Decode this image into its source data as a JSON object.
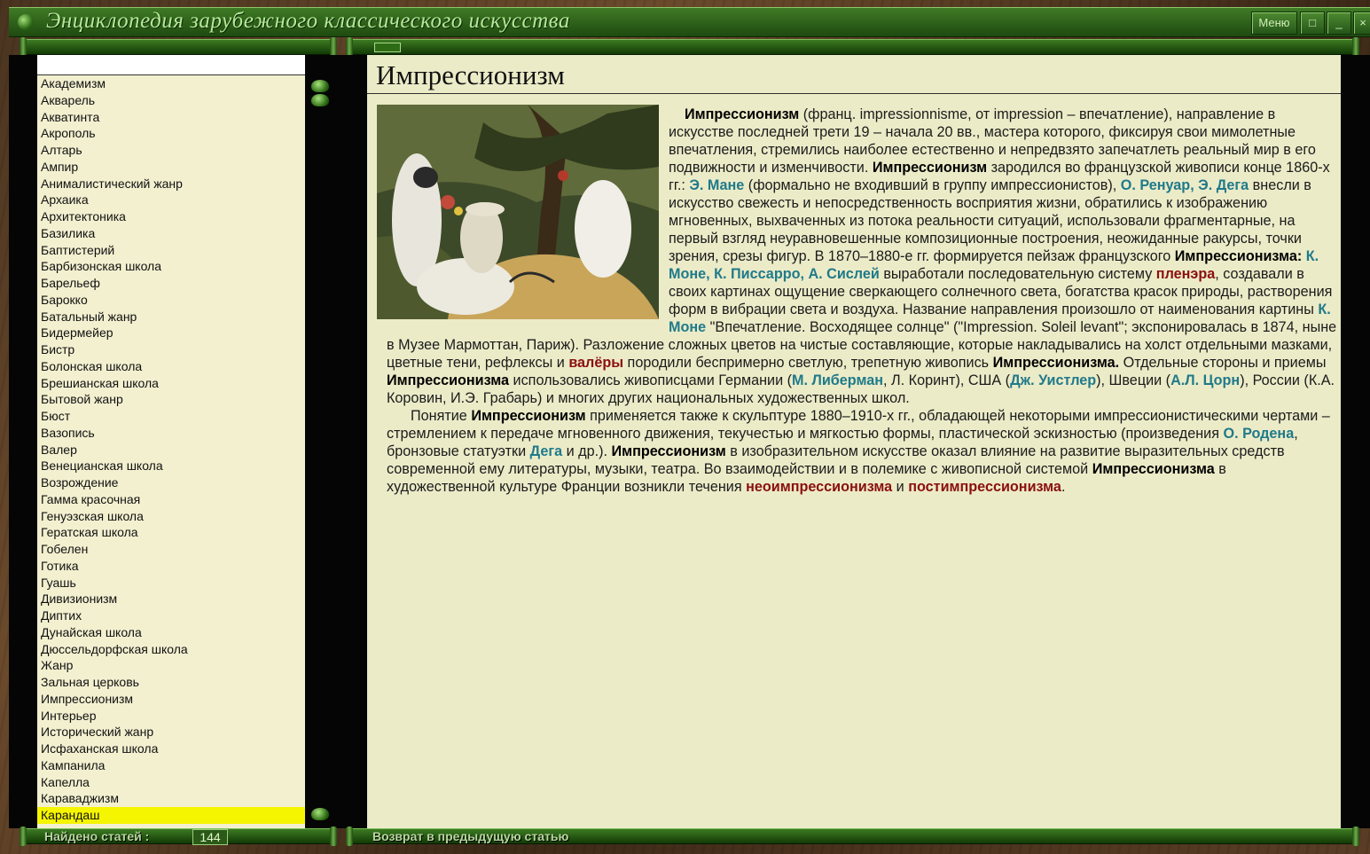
{
  "app": {
    "title": "Энциклопедия зарубежного классического искусства",
    "menu_label": "Меню"
  },
  "sidebar": {
    "search_value": "",
    "items": [
      "Академизм",
      "Акварель",
      "Акватинта",
      "Акрополь",
      "Алтарь",
      "Ампир",
      "Анималистический жанр",
      "Архаика",
      "Архитектоника",
      "Базилика",
      "Баптистерий",
      "Барбизонская школа",
      "Барельеф",
      "Барокко",
      "Батальный жанр",
      "Бидермейер",
      "Бистр",
      "Болонская школа",
      "Брешианская школа",
      "Бытовой жанр",
      "Бюст",
      "Вазопись",
      "Валер",
      "Венецианская школа",
      "Возрождение",
      "Гамма красочная",
      "Генуэзская школа",
      "Гератская школа",
      "Гобелен",
      "Готика",
      "Гуашь",
      "Дивизионизм",
      "Диптих",
      "Дунайская школа",
      "Дюссельдорфская школа",
      "Жанр",
      "Зальная церковь",
      "Импрессионизм",
      "Интерьер",
      "Исторический жанр",
      "Исфаханская школа",
      "Кампанила",
      "Капелла",
      "Караваджизм",
      "Карандаш"
    ],
    "selected_item": "Карандаш"
  },
  "article": {
    "title": "Импрессионизм",
    "image_icon": "painting-image",
    "p1_t1": "Импрессионизм",
    "p1_t2": " (франц. impressionnisme, от impression – впечатление), направление в искусстве последней трети 19 – начала 20 вв., мастера которого, фиксируя свои мимолетные впечатления, стремились наиболее естественно и непредвзято запечатлеть реальный мир в его подвижности и изменчивости. ",
    "p1_t3": "Импрессионизм",
    "p1_t4": " зародился во французской живописи конце 1860-х гг.: ",
    "p1_l1": "Э. Мане",
    "p1_t5": " (формально не входивший в группу импрессионистов), ",
    "p1_l2": "О. Ренуар, Э. Дега",
    "p1_t6": " внесли в искусство свежесть и непосредственность восприятия жизни, обратились к изображению мгновенных, выхваченных из потока реальности ситуаций, использовали фрагментарные, на первый взгляд неуравновешенные композиционные построения, неожиданные ракурсы, точки зрения, срезы фигур. В 1870–1880-е гг. формируется пейзаж французского ",
    "p1_t7": "Импрессионизма:",
    "p1_l3": "К. Моне, К. Писсарро, А. Сислей",
    "p1_t8": " выработали последовательную систему ",
    "p1_m1": "пленэра",
    "p1_t9": ", создавали в своих картинах ощущение сверкающего солнечного света, богатства красок природы, растворения форм в вибрации света и воздуха. Название направления произошло от наименования картины ",
    "p1_l4": "К. Моне",
    "p1_t10": " \"Впечатление. Восходящее солнце\" (\"Impression. Soleil levant\"; экспонировалась в 1874, ныне в Музее Мармоттан, Париж). Разложение сложных цветов на чистые составляющие, которые накладывались на холст отдельными мазками, цветные тени, рефлексы и ",
    "p1_m2": "валёры",
    "p1_t11": " породили беспримерно светлую, трепетную живопись ",
    "p1_t12": "Импрессионизма.",
    "p1_t13": " Отдельные стороны и приемы ",
    "p1_t14": "Импрессионизма",
    "p1_t15": " использовались живописцами Германии (",
    "p1_l5": "М. Либерман",
    "p1_t16": ", Л. Коринт), США (",
    "p1_l6": "Дж. Уистлер",
    "p1_t17": "), Швеции (",
    "p1_l7": "А.Л. Цорн",
    "p1_t18": "), России (К.А. Коровин, И.Э. Грабарь) и многих других национальных художественных школ.",
    "p2_t1": "Понятие ",
    "p2_t2": "Импрессионизм",
    "p2_t3": " применяется также к скульптуре 1880–1910-х гг., обладающей некоторыми импрессионистическими чертами – стремлением к передаче мгновенного движения, текучестью и мягкостью формы, пластической эскизностью (произведения ",
    "p2_l1": "О. Родена",
    "p2_t4": ", бронзовые статуэтки ",
    "p2_l2": "Дега",
    "p2_t5": " и др.). ",
    "p2_t6": "Импрессионизм",
    "p2_t7": " в изобразительном искусстве оказал влияние на развитие выразительных средств современной ему литературы, музыки, театра. Во взаимодействии и в полемике с живописной системой ",
    "p2_t8": "Импрессионизма",
    "p2_t9": " в художественной культуре Франции возникли течения ",
    "p2_m1": "неоимпрессионизма",
    "p2_t10": " и ",
    "p2_m2": "постимпрессионизма",
    "p2_t11": "."
  },
  "status": {
    "count_label": "Найдено статей :",
    "count_value": "144",
    "back_label": "Возврат в предыдущую статью"
  },
  "colors": {
    "frame_green": "#2e6b15",
    "link_teal": "#1f7a8a",
    "term_red": "#8a1010",
    "selected_yellow": "#f5f500",
    "page_bg": "#ecebc8"
  }
}
